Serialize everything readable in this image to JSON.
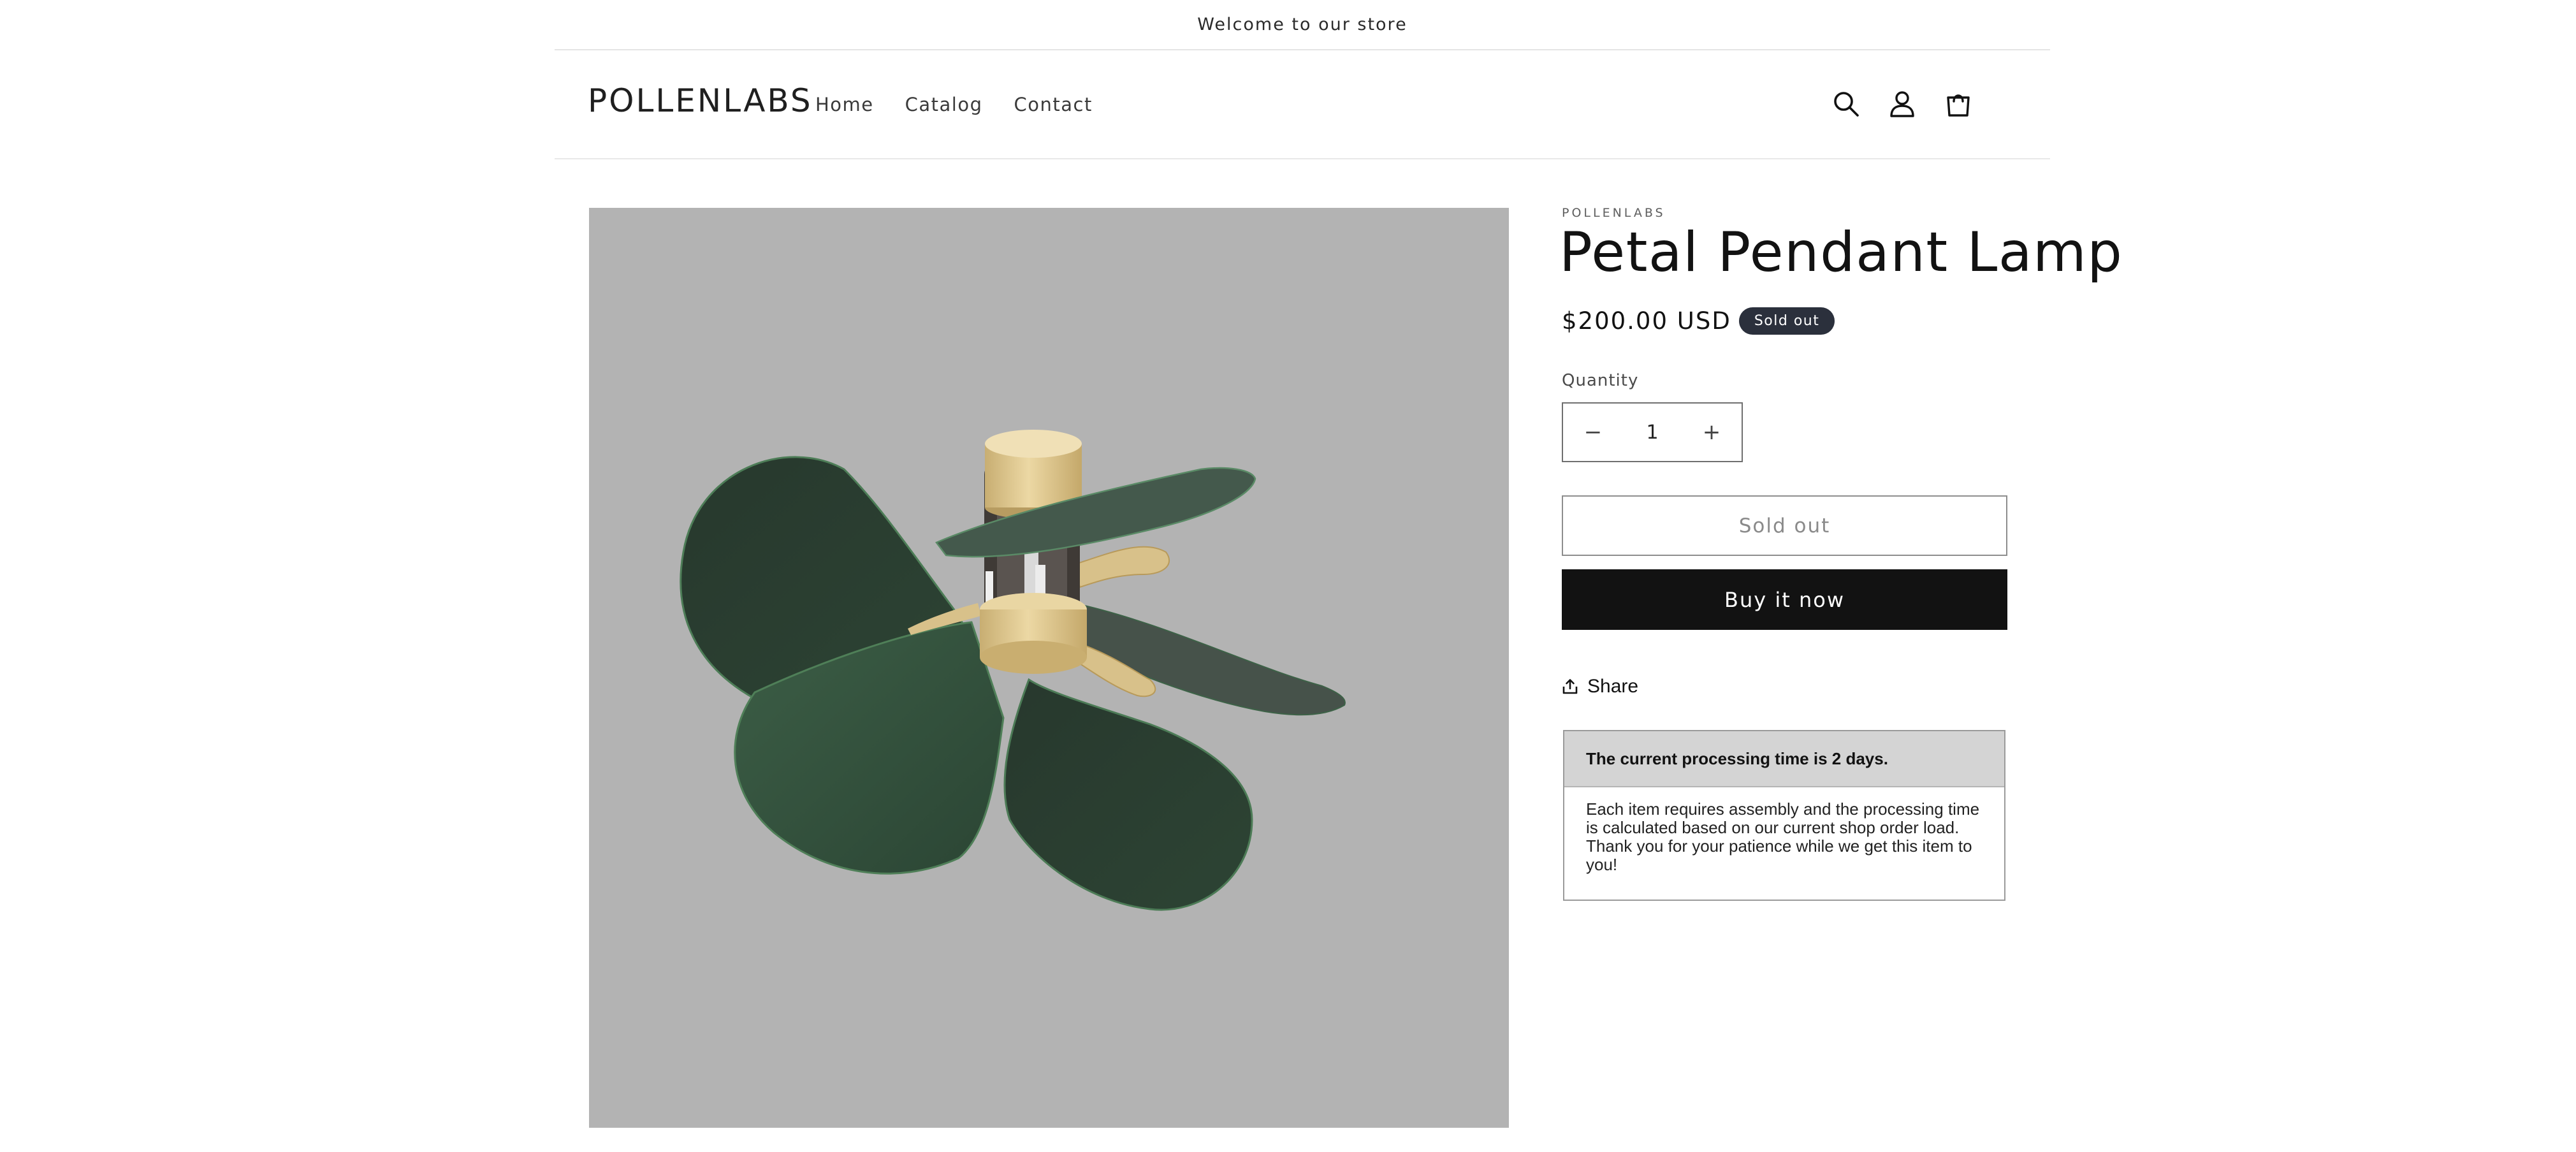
{
  "announcement": {
    "text": "Welcome to our store"
  },
  "header": {
    "logo": "POLLENLABS",
    "nav": [
      {
        "label": "Home"
      },
      {
        "label": "Catalog"
      },
      {
        "label": "Contact"
      }
    ],
    "icons": [
      "search-icon",
      "account-icon",
      "cart-icon"
    ]
  },
  "product": {
    "vendor": "POLLENLABS",
    "title": "Petal Pendant Lamp",
    "price": "$200.00 USD",
    "badge": "Sold out",
    "image_description_colors": {
      "background": "#b3b3b3",
      "petal": "#2f4a38",
      "brass": "#d8c18a"
    },
    "quantity": {
      "label": "Quantity",
      "value": "1",
      "decrease_symbol": "−",
      "increase_symbol": "+"
    },
    "buttons": {
      "sold_out": "Sold out",
      "buy_now": "Buy it now"
    },
    "share": {
      "label": "Share"
    },
    "notice": {
      "heading": "The current processing time is 2 days.",
      "body": "Each item requires assembly and the processing time is calculated based on our current shop order load. Thank you for your patience while we get this item to you!"
    }
  },
  "colors": {
    "primary_button": "#121212",
    "badge": "#2b303c",
    "notice_header": "#d4d4d4"
  }
}
